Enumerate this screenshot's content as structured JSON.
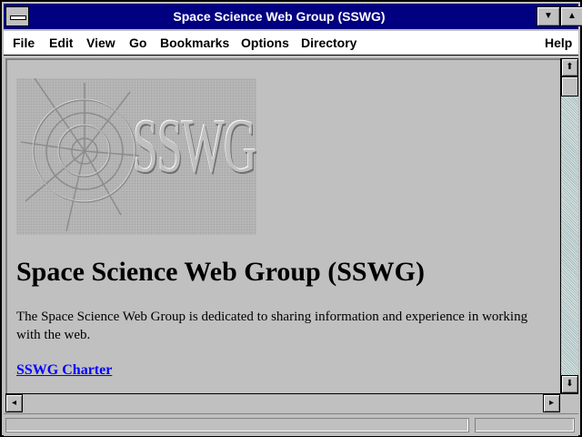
{
  "window": {
    "title": "Space Science Web Group (SSWG)"
  },
  "menu": {
    "file": "File",
    "edit": "Edit",
    "view": "View",
    "go": "Go",
    "bookmarks": "Bookmarks",
    "options": "Options",
    "directory": "Directory",
    "help": "Help"
  },
  "page": {
    "logo_text": "SSWG",
    "heading": "Space Science Web Group (SSWG)",
    "paragraph": "The Space Science Web Group is dedicated to sharing information and experience in working with the web.",
    "link_text": "SSWG Charter"
  },
  "icons": {
    "system_menu": "system-menu-icon",
    "minimize": "minimize-icon",
    "maximize": "maximize-icon",
    "scroll_up": "arrow-up-icon",
    "scroll_down": "arrow-down-icon",
    "scroll_left": "arrow-left-icon",
    "scroll_right": "arrow-right-icon"
  },
  "colors": {
    "titlebar": "#000080",
    "link": "#0000ff",
    "window_bg": "#c0c0c0"
  }
}
